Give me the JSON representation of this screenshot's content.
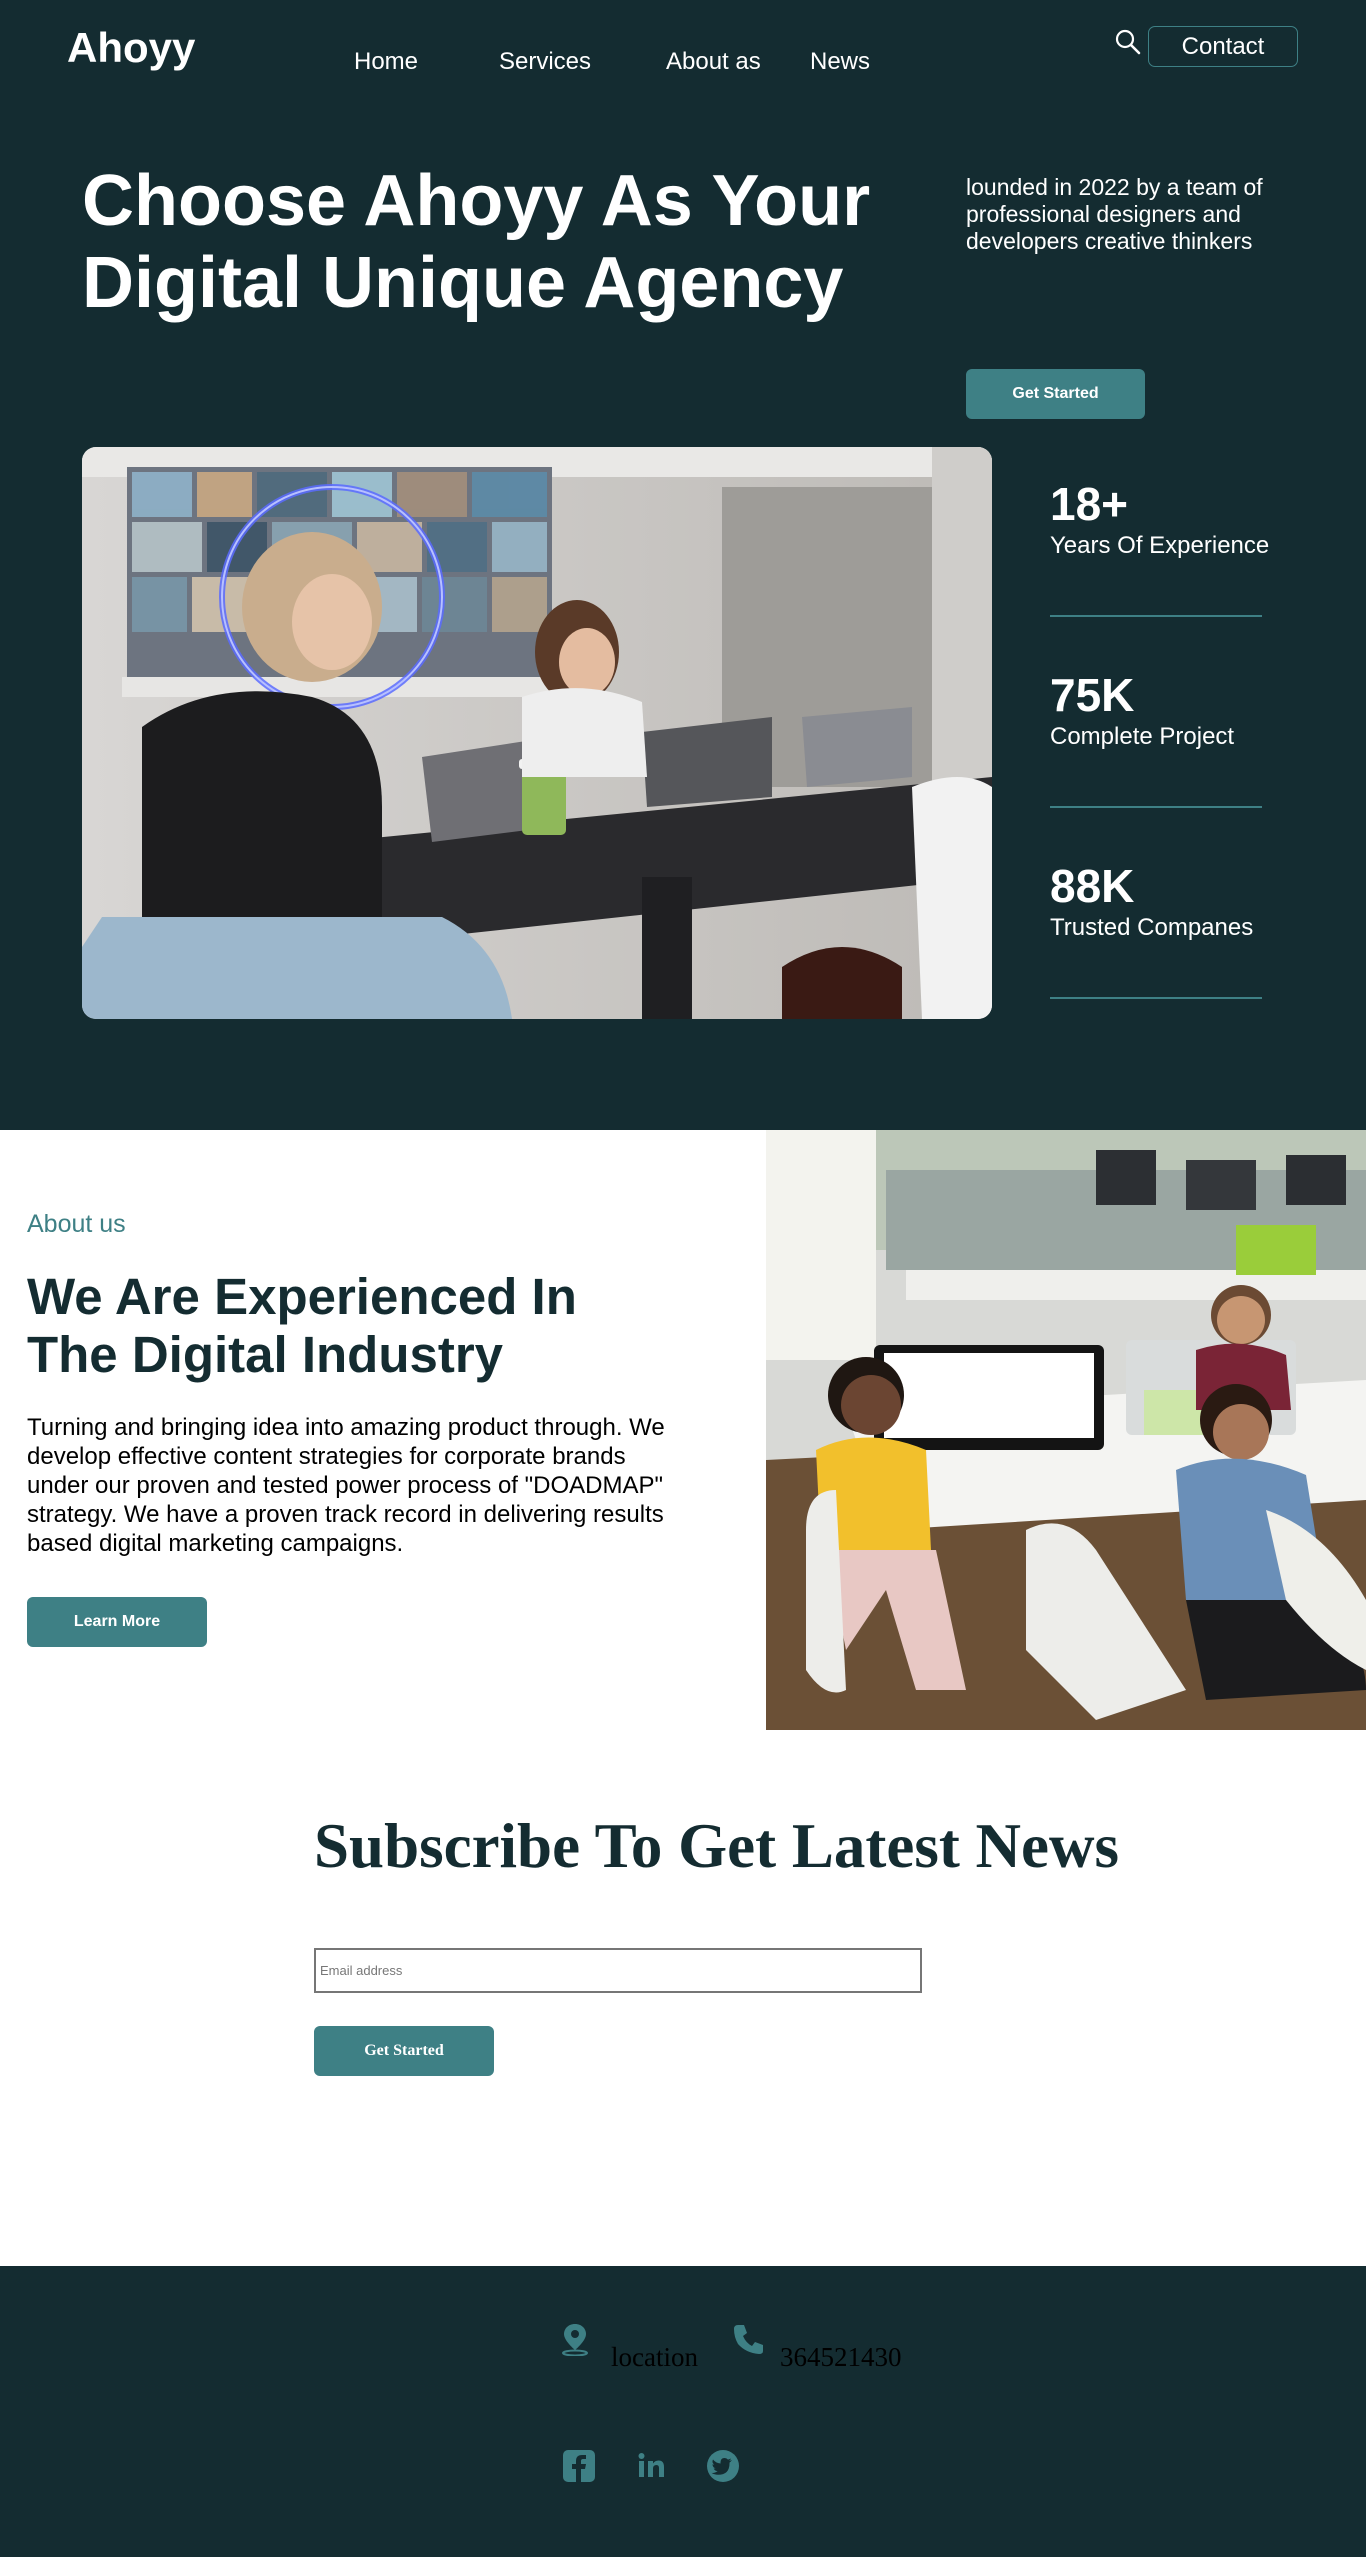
{
  "header": {
    "logo": "Ahoyy",
    "nav": [
      "Home",
      "Services",
      "About as",
      "News"
    ],
    "contact_label": "Contact",
    "search_icon": "search-icon"
  },
  "hero": {
    "title": "Choose Ahoyy As Your Digital Unique Agency",
    "description": "lounded in 2022 by a team of professional designers and developers creative thinkers",
    "cta_label": "Get Started",
    "stats": [
      {
        "value": "18+",
        "label": "Years Of Experience"
      },
      {
        "value": "75K",
        "label": "Complete Project"
      },
      {
        "value": "88K",
        "label": "Trusted Companes"
      }
    ]
  },
  "about": {
    "eyebrow": "About us",
    "title": "We Are Experienced In The Digital Industry",
    "text": "Turning and bringing idea into amazing product through. We develop effective content strategies for corporate brands under our proven and tested power process of \"DOADMAP\" strategy. We have a proven track record in delivering results based digital marketing campaigns.",
    "button_label": "Learn More"
  },
  "subscribe": {
    "title": "Subscribe To Get Latest News",
    "email_placeholder": "Email address",
    "button_label": "Get Started"
  },
  "footer": {
    "location": "location",
    "phone": "364521430",
    "social_icons": [
      "facebook-icon",
      "linkedin-icon",
      "twitter-icon"
    ]
  },
  "colors": {
    "dark": "#142c31",
    "accent": "#3e8085",
    "white": "#ffffff"
  }
}
